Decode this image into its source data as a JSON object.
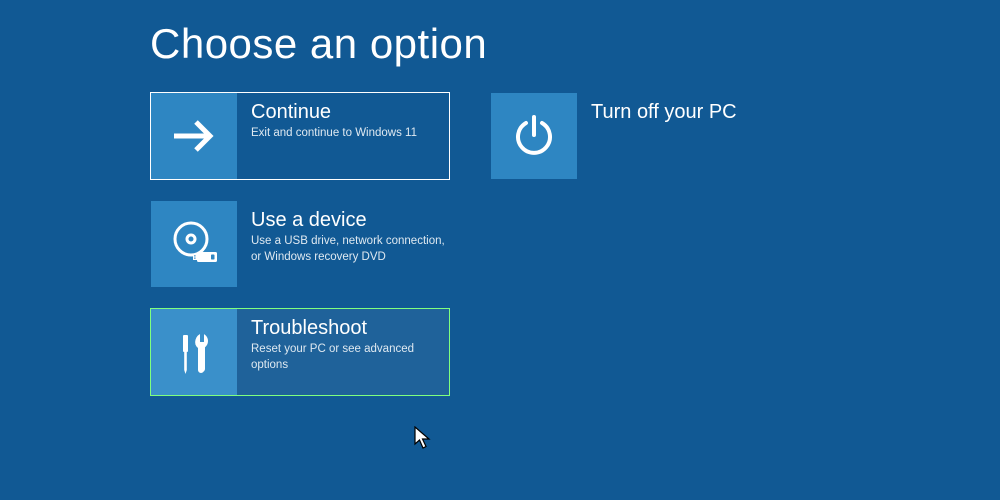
{
  "title": "Choose an option",
  "colors": {
    "background": "#115994",
    "tile_icon_bg": "#2e86c2",
    "selected_border": "#ffffff",
    "hover_border": "#7fff7f"
  },
  "left_column": [
    {
      "id": "continue",
      "label": "Continue",
      "description": "Exit and continue to Windows 11",
      "icon": "arrow-right-icon",
      "state": "selected"
    },
    {
      "id": "use-a-device",
      "label": "Use a device",
      "description": "Use a USB drive, network connection, or Windows recovery DVD",
      "icon": "disc-usb-icon",
      "state": "default"
    },
    {
      "id": "troubleshoot",
      "label": "Troubleshoot",
      "description": "Reset your PC or see advanced options",
      "icon": "tools-icon",
      "state": "hover"
    }
  ],
  "right_column": [
    {
      "id": "turn-off",
      "label": "Turn off your PC",
      "description": "",
      "icon": "power-icon",
      "state": "default"
    }
  ]
}
